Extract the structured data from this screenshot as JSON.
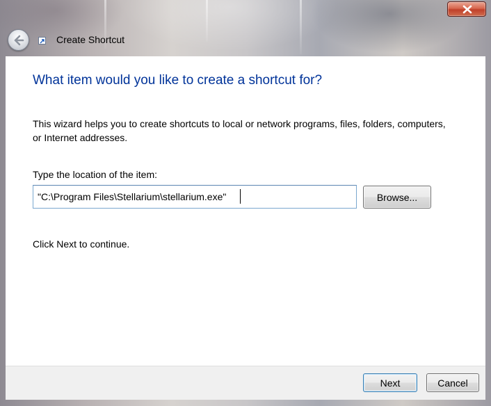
{
  "window": {
    "title": "Create Shortcut",
    "icons": {
      "close": "close-icon",
      "back": "back-arrow-icon",
      "app": "shortcut-wizard-icon"
    }
  },
  "page": {
    "heading": "What item would you like to create a shortcut for?",
    "intro": "This wizard helps you to create shortcuts to local or network programs, files, folders, computers, or Internet addresses.",
    "location_label": "Type the location of the item:",
    "location_value": "\"C:\\Program Files\\Stellarium\\stellarium.exe\"",
    "browse_label": "Browse...",
    "continue_text": "Click Next to continue."
  },
  "footer": {
    "next_label": "Next",
    "cancel_label": "Cancel"
  },
  "colors": {
    "heading": "#003399",
    "close_button": "#c7412b",
    "content_bg": "#ffffff",
    "footer_bg": "#f0f0f0"
  }
}
